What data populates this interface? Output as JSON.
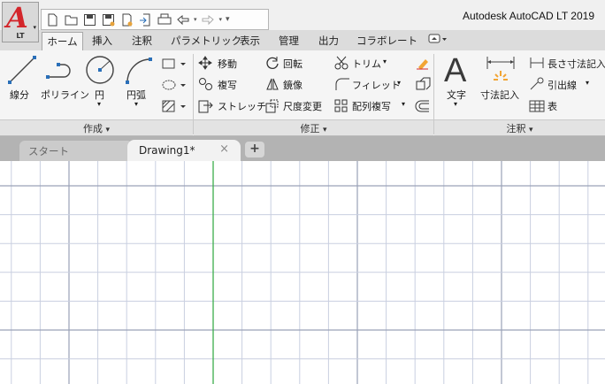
{
  "app": {
    "title": "Autodesk AutoCAD LT 2019",
    "logo_badge": "LT"
  },
  "ribbon_tabs": [
    "ホーム",
    "挿入",
    "注釈",
    "パラメトリック",
    "表示",
    "管理",
    "出力",
    "コラボレート"
  ],
  "draw_panel": {
    "title": "作成",
    "tools": [
      "線分",
      "ポリライン",
      "円",
      "円弧"
    ]
  },
  "modify_panel": {
    "title": "修正",
    "tools": [
      "移動",
      "回転",
      "トリム",
      "複写",
      "鏡像",
      "フィレット",
      "ストレッチ",
      "尺度変更",
      "配列複写"
    ]
  },
  "annotation_panel": {
    "title": "注釈",
    "tools": [
      "文字",
      "寸法記入",
      "長さ寸法記入",
      "引出線",
      "表"
    ]
  },
  "file_tabs": {
    "start": "スタート",
    "drawing": "Drawing1*",
    "close": "×",
    "new": "+"
  },
  "colors": {
    "accent_red": "#d3262b",
    "grid": "#c9cfe0",
    "y_axis": "#3cae4a"
  }
}
